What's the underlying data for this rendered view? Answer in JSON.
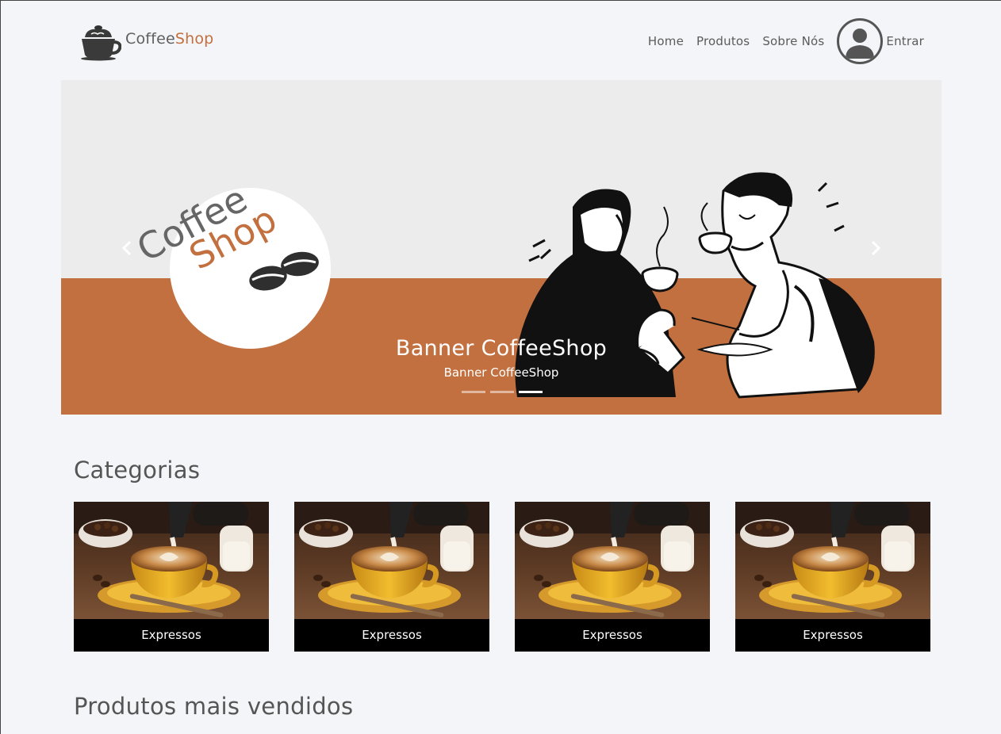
{
  "brand": {
    "name_part1": "Coffee",
    "name_part2": "Shop",
    "accent_color": "#c2703f",
    "icon": "coffee-cup-icon"
  },
  "nav": {
    "items": [
      {
        "label": "Home"
      },
      {
        "label": "Produtos"
      },
      {
        "label": "Sobre Nós"
      }
    ],
    "avatar_icon": "user-avatar-icon",
    "login_label": "Entrar"
  },
  "banner": {
    "logo_text_line1": "Coffee",
    "logo_text_line2": "Shop",
    "caption_title": "Banner CoffeeShop",
    "caption_subtitle": "Banner CoffeeShop",
    "slide_count": 3,
    "active_slide": 3,
    "band_color": "#c2703f",
    "prev_icon": "chevron-left-icon",
    "next_icon": "chevron-right-icon"
  },
  "categories": {
    "title": "Categorias",
    "items": [
      {
        "label": "Expressos",
        "image": "latte-art-coffee-cup"
      },
      {
        "label": "Expressos",
        "image": "latte-art-coffee-cup"
      },
      {
        "label": "Expressos",
        "image": "latte-art-coffee-cup"
      },
      {
        "label": "Expressos",
        "image": "latte-art-coffee-cup"
      }
    ]
  },
  "best_sellers": {
    "title": "Produtos mais vendidos"
  }
}
